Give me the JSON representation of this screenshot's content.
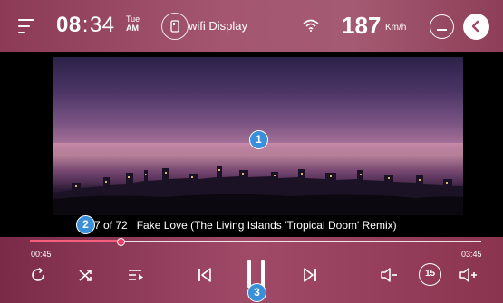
{
  "status_bar": {
    "time_hours": "08",
    "time_minutes": "34",
    "day": "Tue",
    "ampm": "AM",
    "wifi_display_label": "wifi Display",
    "speed_value": "187",
    "speed_unit": "Km/h",
    "icons": [
      "menu-icon",
      "phone-mirror-icon",
      "wifi-icon",
      "minimize-icon",
      "back-icon"
    ]
  },
  "video": {
    "scene": "city skyline at dusk",
    "markers": [
      "1",
      "2",
      "3"
    ]
  },
  "track": {
    "index_label": "7 of 72",
    "title": "Fake Love (The Living Islands 'Tropical Doom' Remix)"
  },
  "playback": {
    "elapsed": "00:45",
    "total": "03:45",
    "progress_fraction": 0.2,
    "rewind_seconds": "15",
    "controls": [
      "repeat-icon",
      "shuffle-icon",
      "playlist-icon",
      "previous-icon",
      "pause-icon",
      "next-icon",
      "volume-down-icon",
      "rewind-15-icon",
      "volume-up-icon"
    ]
  },
  "colors": {
    "accent": "#f03a68",
    "marker": "#3a8fd8",
    "bar": "#a04a68"
  }
}
